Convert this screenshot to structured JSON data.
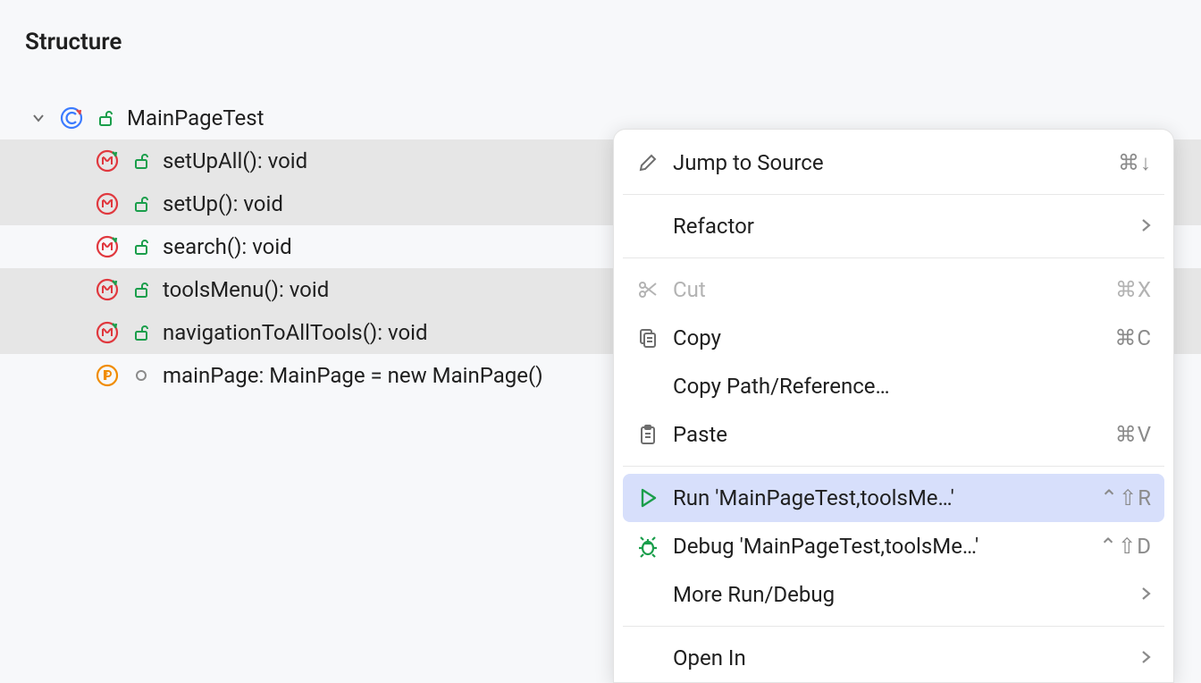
{
  "panel": {
    "title": "Structure"
  },
  "tree": {
    "root": {
      "label": "MainPageTest"
    },
    "items": [
      {
        "label": "setUpAll(): void",
        "icon": "method-with-arrow",
        "selected": true
      },
      {
        "label": "setUp(): void",
        "icon": "method",
        "selected": true
      },
      {
        "label": "search(): void",
        "icon": "method-with-arrow",
        "selected": false
      },
      {
        "label": "toolsMenu(): void",
        "icon": "method-with-arrow",
        "selected": true
      },
      {
        "label": "navigationToAllTools(): void",
        "icon": "method-with-arrow",
        "selected": true
      },
      {
        "label": "mainPage: MainPage = new MainPage()",
        "icon": "field",
        "selected": false
      }
    ]
  },
  "menu": {
    "items": [
      {
        "label": "Jump to Source",
        "icon": "pencil-icon",
        "shortcut": "⌘↓",
        "submenu": false,
        "disabled": false,
        "highlight": false,
        "sepAfter": true
      },
      {
        "label": "Refactor",
        "icon": "",
        "shortcut": "",
        "submenu": true,
        "disabled": false,
        "highlight": false,
        "sepAfter": true
      },
      {
        "label": "Cut",
        "icon": "scissors-icon",
        "shortcut": "⌘X",
        "submenu": false,
        "disabled": true,
        "highlight": false,
        "sepAfter": false
      },
      {
        "label": "Copy",
        "icon": "copy-icon",
        "shortcut": "⌘C",
        "submenu": false,
        "disabled": false,
        "highlight": false,
        "sepAfter": false
      },
      {
        "label": "Copy Path/Reference…",
        "icon": "",
        "shortcut": "",
        "submenu": false,
        "disabled": false,
        "highlight": false,
        "sepAfter": false
      },
      {
        "label": "Paste",
        "icon": "clipboard-icon",
        "shortcut": "⌘V",
        "submenu": false,
        "disabled": false,
        "highlight": false,
        "sepAfter": true
      },
      {
        "label": "Run 'MainPageTest,toolsMe…'",
        "icon": "run-icon",
        "shortcut": "⌃⇧R",
        "submenu": false,
        "disabled": false,
        "highlight": true,
        "sepAfter": false
      },
      {
        "label": "Debug 'MainPageTest,toolsMe…'",
        "icon": "debug-icon",
        "shortcut": "⌃⇧D",
        "submenu": false,
        "disabled": false,
        "highlight": false,
        "sepAfter": false
      },
      {
        "label": "More Run/Debug",
        "icon": "",
        "shortcut": "",
        "submenu": true,
        "disabled": false,
        "highlight": false,
        "sepAfter": true
      },
      {
        "label": "Open In",
        "icon": "",
        "shortcut": "",
        "submenu": true,
        "disabled": false,
        "highlight": false,
        "sepAfter": false
      }
    ]
  }
}
